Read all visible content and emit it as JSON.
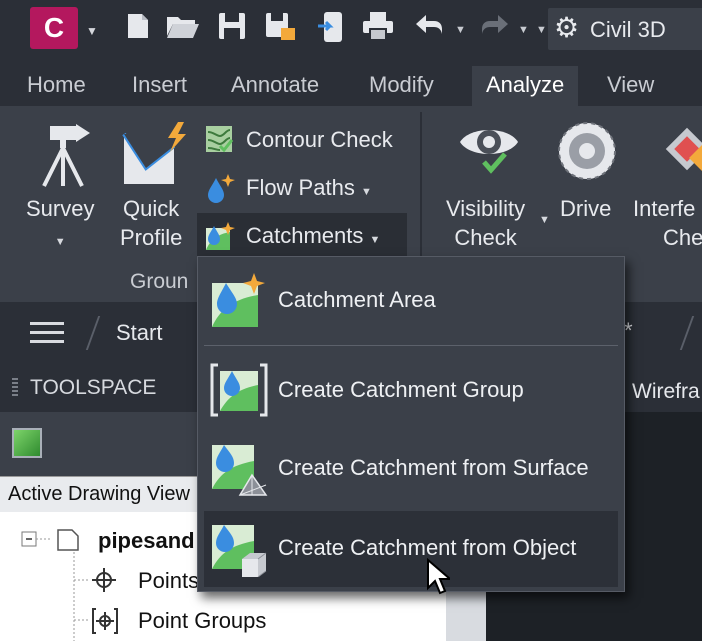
{
  "app": {
    "logo_letter": "C",
    "workspace": "Civil 3D"
  },
  "quick_access": {
    "icons": [
      "new-file-icon",
      "open-folder-icon",
      "save-icon",
      "save-as-icon",
      "share-icon",
      "print-icon",
      "undo-icon",
      "redo-icon"
    ]
  },
  "tabs": [
    "Home",
    "Insert",
    "Annotate",
    "Modify",
    "Analyze",
    "View"
  ],
  "active_tab": "Analyze",
  "ribbon": {
    "survey": "Survey",
    "quick_profile_line1": "Quick",
    "quick_profile_line2": "Profile",
    "contour_check": "Contour Check",
    "flow_paths": "Flow Paths",
    "catchments": "Catchments",
    "panel_label": "Groun",
    "visibility_line1": "Visibility",
    "visibility_line2": "Check",
    "drive": "Drive",
    "interference_line1": "Interfe",
    "interference_line2": "Che"
  },
  "file_tabs": {
    "start": "Start",
    "star": "*"
  },
  "menu": {
    "items": [
      "Catchment Area",
      "Create Catchment Group",
      "Create Catchment from Surface",
      "Create Catchment from Object"
    ],
    "hovered_index": 3
  },
  "toolspace": {
    "title": "TOOLSPACE",
    "view_selector": "Active Drawing View",
    "tree": {
      "root": "pipesand",
      "children": [
        "Points",
        "Point Groups"
      ]
    }
  },
  "viewport": {
    "visual_style": "Wirefra"
  },
  "colors": {
    "titlebar": "#2b2f37",
    "ribbon": "#3b4049",
    "logo": "#b4185e",
    "accent_orange": "#f3a93b",
    "accent_green": "#5fbf5f",
    "drop_blue": "#3a8de0"
  }
}
